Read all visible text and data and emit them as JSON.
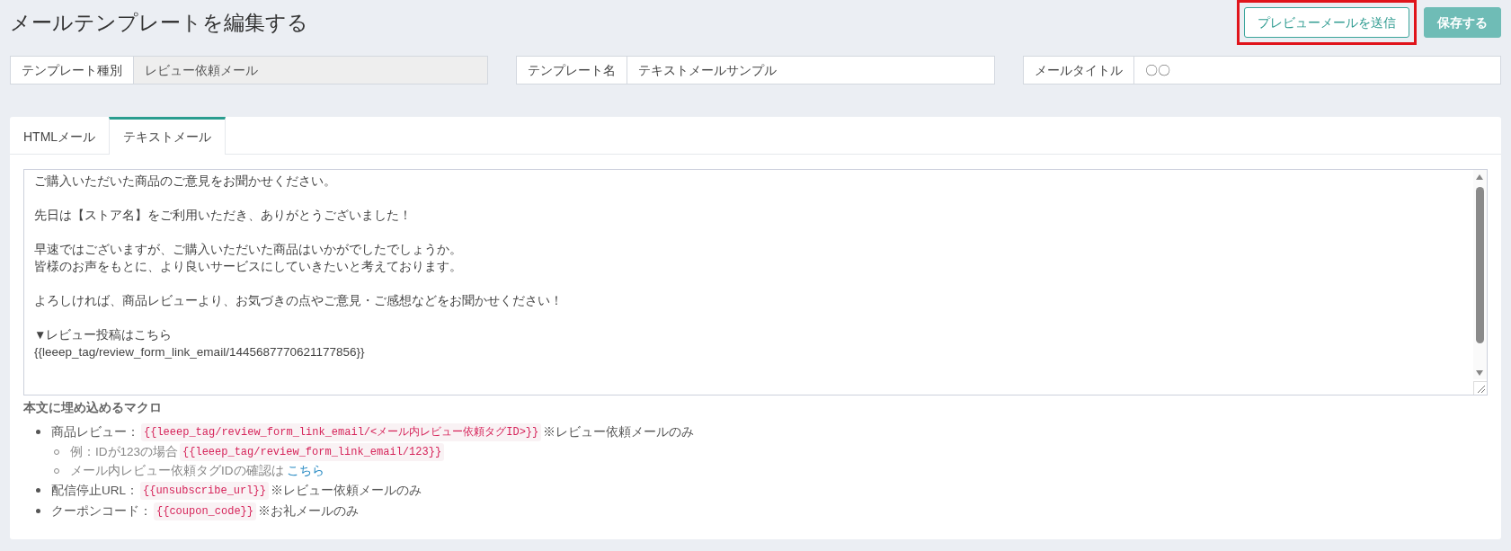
{
  "page_title": "メールテンプレートを編集する",
  "header_buttons": [
    {
      "label": "プレビューメールを送信",
      "kind": "outline",
      "highlighted": true
    },
    {
      "label": "保存する",
      "kind": "primary",
      "highlighted": false
    }
  ],
  "fields": [
    {
      "label": "テンプレート種別",
      "value": "レビュー依頼メール",
      "disabled": true
    },
    {
      "label": "テンプレート名",
      "value": "テキストメールサンプル",
      "disabled": false
    },
    {
      "label": "メールタイトル",
      "value": "〇〇",
      "disabled": false
    }
  ],
  "tabs": [
    {
      "label": "HTMLメール",
      "selected": false
    },
    {
      "label": "テキストメール",
      "selected": true
    }
  ],
  "body_paragraphs": [
    [
      "ご購入いただいた商品のご意見をお聞かせください。"
    ],
    [
      "先日は【ストア名】をご利用いただき、ありがとうございました！"
    ],
    [
      "早速ではございますが、ご購入いただいた商品はいかがでしたでしょうか。",
      "皆様のお声をもとに、より良いサービスにしていきたいと考えております。"
    ],
    [
      "よろしければ、商品レビューより、お気づきの点やご意見・ご感想などをお聞かせください！"
    ],
    [
      "▼レビュー投稿はこちら",
      "{{leeep_tag/review_form_link_email/1445687770621177856}}"
    ]
  ],
  "macros": {
    "heading": "本文に埋め込めるマクロ",
    "items": [
      {
        "label": "商品レビュー：",
        "code": "{{leeep_tag/review_form_link_email/<メール内レビュー依頼タグID>}}",
        "note": "※レビュー依頼メールのみ",
        "children": [
          {
            "text": "例：IDが123の場合",
            "code": "{{leeep_tag/review_form_link_email/123}}"
          },
          {
            "text": "メール内レビュー依頼タグIDの確認は",
            "link": "こちら"
          }
        ]
      },
      {
        "label": "配信停止URL：",
        "code": "{{unsubscribe_url}}",
        "note": "※レビュー依頼メールのみ"
      },
      {
        "label": "クーポンコード：",
        "code": "{{coupon_code}}",
        "note": "※お礼メールのみ"
      }
    ]
  }
}
